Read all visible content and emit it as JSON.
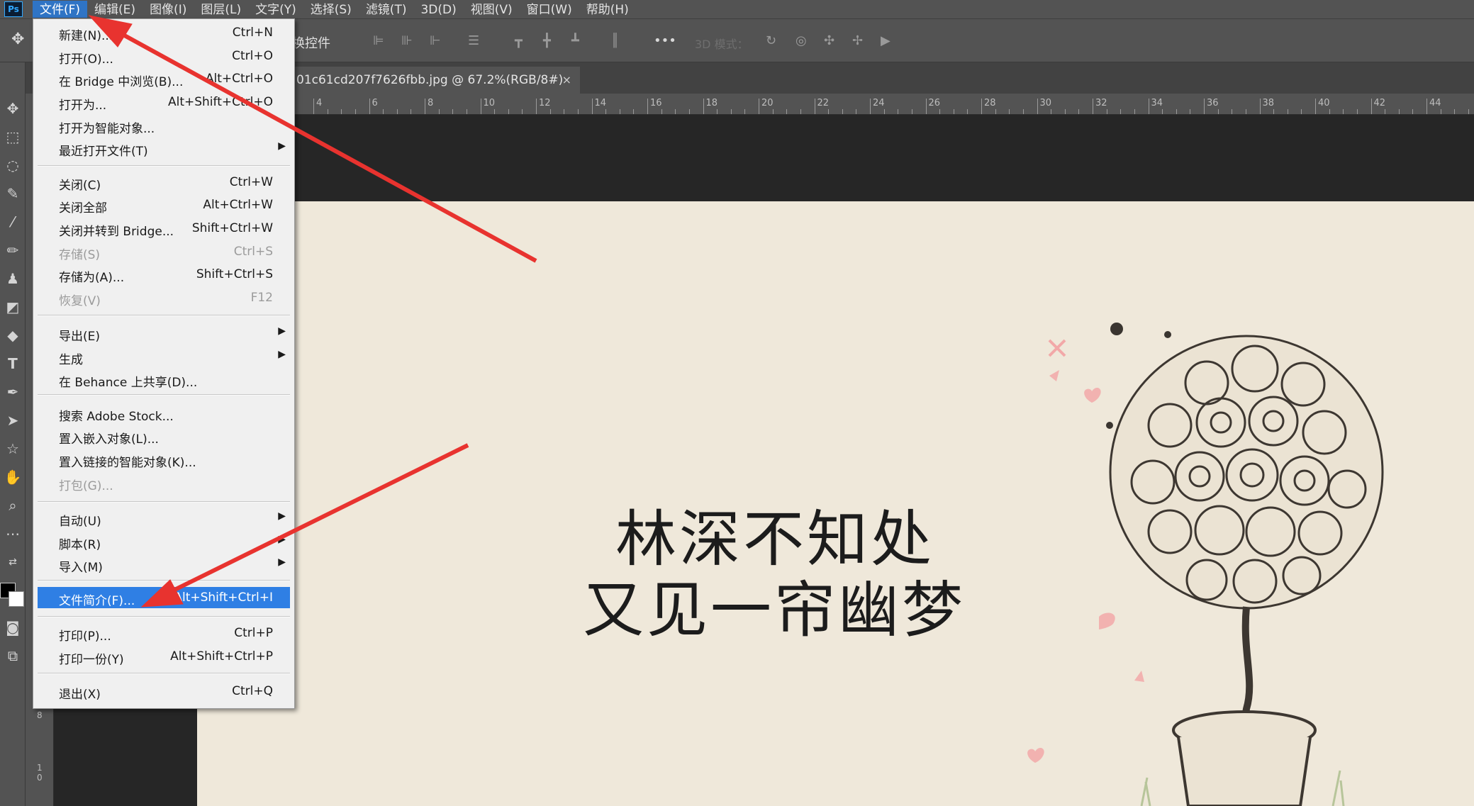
{
  "app": {
    "logo": "Ps"
  },
  "menubar": {
    "items": [
      "文件(F)",
      "编辑(E)",
      "图像(I)",
      "图层(L)",
      "文字(Y)",
      "选择(S)",
      "滤镜(T)",
      "3D(D)",
      "视图(V)",
      "窗口(W)",
      "帮助(H)"
    ]
  },
  "options": {
    "label": "换控件",
    "mode_3d": "3D 模式：",
    "more_icon": "•••"
  },
  "document": {
    "tab_title": "01c61cd207f7626fbb.jpg @ 67.2%(RGB/8#)",
    "close": "×"
  },
  "ruler": {
    "numbers": [
      "4",
      "6",
      "8",
      "10",
      "12",
      "14",
      "16",
      "18",
      "20",
      "22",
      "24",
      "26",
      "28",
      "30",
      "32",
      "34",
      "36",
      "38",
      "40",
      "42",
      "44"
    ],
    "v_numbers": [
      "8",
      "1",
      "0"
    ]
  },
  "file_menu": {
    "items": [
      {
        "label": "新建(N)...",
        "shortcut": "Ctrl+N",
        "disabled": false
      },
      {
        "label": "打开(O)...",
        "shortcut": "Ctrl+O",
        "disabled": false
      },
      {
        "label": "在 Bridge 中浏览(B)...",
        "shortcut": "Alt+Ctrl+O",
        "disabled": false
      },
      {
        "label": "打开为...",
        "shortcut": "Alt+Shift+Ctrl+O",
        "disabled": false
      },
      {
        "label": "打开为智能对象...",
        "shortcut": "",
        "disabled": false
      },
      {
        "label": "最近打开文件(T)",
        "shortcut": "",
        "submenu": true,
        "disabled": false
      },
      {
        "label": "关闭(C)",
        "shortcut": "Ctrl+W",
        "disabled": false
      },
      {
        "label": "关闭全部",
        "shortcut": "Alt+Ctrl+W",
        "disabled": false
      },
      {
        "label": "关闭并转到 Bridge...",
        "shortcut": "Shift+Ctrl+W",
        "disabled": false
      },
      {
        "label": "存储(S)",
        "shortcut": "Ctrl+S",
        "disabled": true
      },
      {
        "label": "存储为(A)...",
        "shortcut": "Shift+Ctrl+S",
        "disabled": false
      },
      {
        "label": "恢复(V)",
        "shortcut": "F12",
        "disabled": true
      },
      {
        "label": "导出(E)",
        "shortcut": "",
        "submenu": true,
        "disabled": false
      },
      {
        "label": "生成",
        "shortcut": "",
        "submenu": true,
        "disabled": false
      },
      {
        "label": "在 Behance 上共享(D)...",
        "shortcut": "",
        "disabled": false
      },
      {
        "label": "搜索 Adobe Stock...",
        "shortcut": "",
        "disabled": false
      },
      {
        "label": "置入嵌入对象(L)...",
        "shortcut": "",
        "disabled": false
      },
      {
        "label": "置入链接的智能对象(K)...",
        "shortcut": "",
        "disabled": false
      },
      {
        "label": "打包(G)...",
        "shortcut": "",
        "disabled": true
      },
      {
        "label": "自动(U)",
        "shortcut": "",
        "submenu": true,
        "disabled": false
      },
      {
        "label": "脚本(R)",
        "shortcut": "",
        "submenu": true,
        "disabled": false
      },
      {
        "label": "导入(M)",
        "shortcut": "",
        "submenu": true,
        "disabled": false
      },
      {
        "label": "文件简介(F)...",
        "shortcut": "Alt+Shift+Ctrl+I",
        "disabled": false,
        "highlighted": true
      },
      {
        "label": "打印(P)...",
        "shortcut": "Ctrl+P",
        "disabled": false
      },
      {
        "label": "打印一份(Y)",
        "shortcut": "Alt+Shift+Ctrl+P",
        "disabled": false
      },
      {
        "label": "退出(X)",
        "shortcut": "Ctrl+Q",
        "disabled": false
      }
    ]
  },
  "canvas": {
    "line1": "林深不知处",
    "line2": "又见一帘幽梦",
    "background": "#efe8da"
  },
  "colors": {
    "highlight": "#2f7fe4",
    "annotation_arrow": "#e8332f"
  },
  "tools": [
    "move-icon",
    "marquee-icon",
    "lasso-icon",
    "quick-select-icon",
    "eyedropper-icon",
    "brush-icon",
    "stamp-icon",
    "eraser-icon",
    "paint-bucket-icon",
    "type-icon",
    "pen-icon",
    "path-select-icon",
    "shape-icon",
    "hand-icon",
    "zoom-icon",
    "more-tools-icon"
  ]
}
